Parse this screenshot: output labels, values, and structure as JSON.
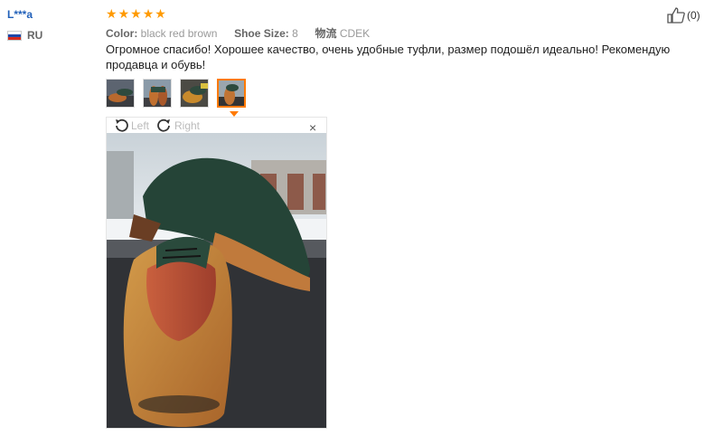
{
  "user": {
    "name": "L***a",
    "country": "RU"
  },
  "rating": {
    "stars": 5,
    "max": 5
  },
  "helpful": {
    "count": "(0)"
  },
  "attributes": [
    {
      "key": "Color:",
      "value": "black red brown"
    },
    {
      "key": "Shoe Size:",
      "value": "8"
    },
    {
      "key": "物流",
      "value": "CDEK"
    }
  ],
  "review_text": "Огромное спасибо! Хорошее качество, очень удобные туфли, размер подошёл идеально! Рекомендую продавца и обувь!",
  "thumbnails": {
    "count": 4,
    "active_index": 3
  },
  "viewer": {
    "rotate_left": "Left",
    "rotate_right": "Right",
    "close": "×"
  },
  "colors": {
    "accent": "#ff7a00",
    "username": "#2160b9",
    "star": "#ff9a00"
  }
}
